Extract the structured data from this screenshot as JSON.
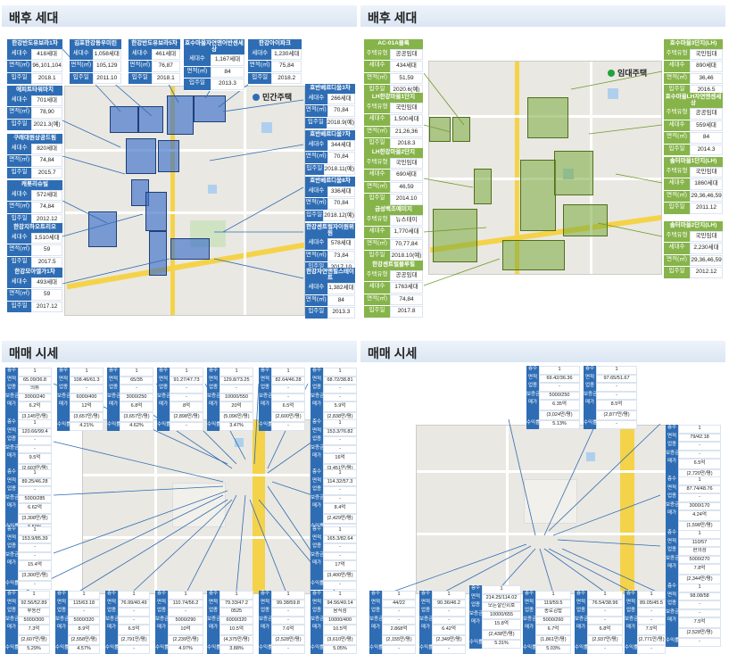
{
  "sections": {
    "tl": "배후 세대",
    "tr": "배후 세대",
    "bl": "매매 시세",
    "br": "매매 시세"
  },
  "legend": {
    "private": "민간주택",
    "rental": "임대주택"
  },
  "colors": {
    "blue": "#2e6db4",
    "green": "#86b44a"
  },
  "tl_boxes": [
    {
      "h": "한강반도유보라1차",
      "rows": [
        [
          "세대수",
          "418세대"
        ],
        [
          "면적(㎡)",
          "96,101,104"
        ],
        [
          "입주일",
          "2018.1"
        ]
      ]
    },
    {
      "h": "김포한강동우미린",
      "rows": [
        [
          "세대수",
          "1,058세대"
        ],
        [
          "면적(㎡)",
          "105,129"
        ],
        [
          "입주일",
          "2011.10"
        ]
      ]
    },
    {
      "h": "한강반도유보라5차",
      "rows": [
        [
          "세대수",
          "461세대"
        ],
        [
          "면적(㎡)",
          "76,87"
        ],
        [
          "입주일",
          "2018.1"
        ]
      ]
    },
    {
      "h": "호수마을자연앤어반센세상",
      "rows": [
        [
          "세대수",
          "1,167세대"
        ],
        [
          "면적(㎡)",
          "84"
        ],
        [
          "입주일",
          "2013.3"
        ]
      ]
    },
    {
      "h": "한강아이파크",
      "rows": [
        [
          "세대수",
          "1,230세대"
        ],
        [
          "면적(㎡)",
          "75,84"
        ],
        [
          "입주일",
          "2018.2"
        ]
      ]
    },
    {
      "h": "에피트타워마치",
      "rows": [
        [
          "세대수",
          "701세대"
        ],
        [
          "면적(㎡)",
          "78,90"
        ],
        [
          "입주일",
          "2021.3(예)"
        ]
      ]
    },
    {
      "h": "구래대원상공드림",
      "rows": [
        [
          "세대수",
          "820세대"
        ],
        [
          "면적(㎡)",
          "74,84"
        ],
        [
          "입주일",
          "2015.7"
        ]
      ]
    },
    {
      "h": "캐롯리슈빌",
      "rows": [
        [
          "세대수",
          "572세대"
        ],
        [
          "면적(㎡)",
          "74,84"
        ],
        [
          "입주일",
          "2012.12"
        ]
      ]
    },
    {
      "h": "한강지하오트리오",
      "rows": [
        [
          "세대수",
          "1,510세대"
        ],
        [
          "면적(㎡)",
          "59"
        ],
        [
          "입주일",
          "2017.5"
        ]
      ]
    },
    {
      "h": "한강모아엘가1차",
      "rows": [
        [
          "세대수",
          "493세대"
        ],
        [
          "면적(㎡)",
          "59"
        ],
        [
          "입주일",
          "2017.12"
        ]
      ]
    },
    {
      "h": "호반베르디움3차",
      "rows": [
        [
          "세대수",
          "266세대"
        ],
        [
          "면적(㎡)",
          "70,84"
        ],
        [
          "입주일",
          "2018.9(예)"
        ]
      ]
    },
    {
      "h": "호반베르디움7차",
      "rows": [
        [
          "세대수",
          "344세대"
        ],
        [
          "면적(㎡)",
          "70,84"
        ],
        [
          "입주일",
          "2018.11(예)"
        ]
      ]
    },
    {
      "h": "호반베르디움8차",
      "rows": [
        [
          "세대수",
          "336세대"
        ],
        [
          "면적(㎡)",
          "70,84"
        ],
        [
          "입주일",
          "2018.12(예)"
        ]
      ]
    },
    {
      "h": "한강센트럴자이원위원",
      "rows": [
        [
          "세대수",
          "578세대"
        ],
        [
          "면적(㎡)",
          "73,84"
        ],
        [
          "입주일",
          "2017.10"
        ]
      ]
    },
    {
      "h": "한강자연앤힐스테이트",
      "rows": [
        [
          "세대수",
          "1,382세대"
        ],
        [
          "면적(㎡)",
          "84"
        ],
        [
          "입주일",
          "2013.3"
        ]
      ]
    }
  ],
  "tr_boxes": [
    {
      "h": "AC-01A블록",
      "rows": [
        [
          "주택유형",
          "공공임대"
        ],
        [
          "세대수",
          "434세대"
        ],
        [
          "면적(㎡)",
          "51,59"
        ],
        [
          "입주일",
          "2020.6(예)"
        ]
      ]
    },
    {
      "h": "LH한강마을1단지",
      "rows": [
        [
          "주택유형",
          "국민임대"
        ],
        [
          "세대수",
          "1,500세대"
        ],
        [
          "면적(㎡)",
          "21,26,36"
        ],
        [
          "입주일",
          "2018.3"
        ]
      ]
    },
    {
      "h": "LH한강마을2단지",
      "rows": [
        [
          "주택유형",
          "국민임대"
        ],
        [
          "세대수",
          "690세대"
        ],
        [
          "면적(㎡)",
          "46,59"
        ],
        [
          "입주일",
          "2014.10"
        ]
      ]
    },
    {
      "h": "금성백조예미지",
      "rows": [
        [
          "주택유형",
          "뉴스테이"
        ],
        [
          "세대수",
          "1,770세대"
        ],
        [
          "면적(㎡)",
          "70,77,84"
        ],
        [
          "입주일",
          "2018.10(예)"
        ]
      ]
    },
    {
      "h": "한강센트럴블루힐",
      "rows": [
        [
          "주택유형",
          "공공임대"
        ],
        [
          "세대수",
          "1763세대"
        ],
        [
          "면적(㎡)",
          "74,84"
        ],
        [
          "입주일",
          "2017.8"
        ]
      ]
    },
    {
      "h": "호수마을3단지(LH)",
      "rows": [
        [
          "주택유형",
          "국민임대"
        ],
        [
          "세대수",
          "890세대"
        ],
        [
          "면적(㎡)",
          "36,46"
        ],
        [
          "입주일",
          "2016.5"
        ]
      ]
    },
    {
      "h": "호수마을LH자연앤센세상",
      "rows": [
        [
          "주택유형",
          "공공임대"
        ],
        [
          "세대수",
          "559세대"
        ],
        [
          "면적(㎡)",
          "84"
        ],
        [
          "입주일",
          "2014.3"
        ]
      ]
    },
    {
      "h": "솔터마을1단지(LH)",
      "rows": [
        [
          "주택유형",
          "국민임대"
        ],
        [
          "세대수",
          "1860세대"
        ],
        [
          "면적(㎡)",
          "29,36,46,59"
        ],
        [
          "입주일",
          "2011.12"
        ]
      ]
    },
    {
      "h": "솔터마을2단지(LH)",
      "rows": [
        [
          "주택유형",
          "국민임대"
        ],
        [
          "세대수",
          "2,230세대"
        ],
        [
          "면적(㎡)",
          "29,36,46,59"
        ],
        [
          "입주일",
          "2012.12"
        ]
      ]
    }
  ],
  "bl_cards": [
    [
      "1",
      "65.09/36.8",
      "의류",
      "3000/240",
      "6.2억",
      "(3,145만/평)",
      "4.88%"
    ],
    [
      "1",
      "108.46/61.3",
      "-",
      "6000/400",
      "12억",
      "(3,657만/평)",
      "4.21%"
    ],
    [
      "1",
      "65/35",
      "-",
      "3000/250",
      "6.8억",
      "(3,657만/평)",
      "4.62%"
    ],
    [
      "1",
      "91.27/47.73",
      "-",
      "-",
      "8억",
      "(2,898만/평)",
      "-"
    ],
    [
      "1",
      "129.8/73.25",
      "-",
      "10000/550",
      "20억",
      "(5,096만/평)",
      "3.47%"
    ],
    [
      "1",
      "82.64/46.28",
      "-",
      "-",
      "6.5억",
      "(2,600만/평)",
      "-"
    ],
    [
      "1",
      "68.72/38.81",
      "-",
      "-",
      "5.9억",
      "(2,838만/평)",
      "-"
    ],
    [
      "1",
      "120.66/99.4",
      "-",
      "-",
      "9.5억",
      "(2,603만/평)",
      "-"
    ],
    [
      "1",
      "153.3/76.82",
      "-",
      "-",
      "16억",
      "(3,451만/평)",
      "-"
    ],
    [
      "1",
      "89.25/46.28",
      "-",
      "5000/285",
      "6.62억",
      "(3,308만/평)",
      "5.59%"
    ],
    [
      "1",
      "114.32/57.3",
      "-",
      "-",
      "8.4억",
      "(2,429만/평)",
      "-"
    ],
    [
      "1",
      "153.9/85.39",
      "-",
      "-",
      "15.4억",
      "(3,300만/평)",
      "-"
    ],
    [
      "1",
      "165.3/82.64",
      "-",
      "-",
      "17억",
      "(3,400만/평)",
      "-"
    ],
    [
      "1",
      "92.56/52.89",
      "부동산",
      "5000/300",
      "7.3억",
      "(2,607만/평)",
      "5.29%"
    ],
    [
      "1",
      "115/63.18",
      "-",
      "5000/320",
      "8.9억",
      "(2,558만/평)",
      "4.57%"
    ],
    [
      "1",
      "76.99/40.49",
      "-",
      "-",
      "6.5억",
      "(2,791만/평)",
      "-"
    ],
    [
      "1",
      "110.74/56.2",
      "-",
      "5000/290",
      "10억",
      "(2,239만/평)",
      "4.97%"
    ],
    [
      "1",
      "79.33/47.2",
      "0525",
      "6000/320",
      "10.5억",
      "(4,375만/평)",
      "3.88%"
    ],
    [
      "1",
      "99.38/59.8",
      "-",
      "-",
      "7.6억",
      "(2,528만/평)",
      "-"
    ],
    [
      "1",
      "94.56/49.14",
      "음식점",
      "10000/400",
      "10.5억",
      "(3,610만/평)",
      "5.05%"
    ]
  ],
  "br_cards": [
    [
      "1",
      "69.42/36.36",
      "-",
      "5000/250",
      "6.35억",
      "(3,024만/평)",
      "5.13%"
    ],
    [
      "1",
      "97.65/51.67",
      "-",
      "-",
      "8.5억",
      "(2,877만/평)",
      "-"
    ],
    [
      "1",
      "79/42.18",
      "-",
      "-",
      "6.5억",
      "(2,720만/평)",
      "-"
    ],
    [
      "1",
      "87.74/48.76",
      "-",
      "3000/170",
      "4.24억",
      "(1,598만/평)",
      "5.18%"
    ],
    [
      "1",
      "110/57",
      "편의점",
      "5000/270",
      "7.8억",
      "(2,344만/평)",
      "4.44%"
    ],
    [
      "1",
      "98.08/58",
      "-",
      "-",
      "7.5억",
      "(2,528만/평)",
      "-"
    ],
    [
      "1",
      "44/22",
      "-",
      "-",
      "2.868억",
      "(2,155만/평)",
      "-"
    ],
    [
      "1",
      "90.36/46.2",
      "-",
      "-",
      "6.42억",
      "(2,349만/평)",
      "-"
    ],
    [
      "1",
      "214.25/114.02",
      "모든절인회호",
      "10000/655",
      "15.8억",
      "(2,438만/평)",
      "5.31%"
    ],
    [
      "1",
      "119/59.5",
      "종로김밥",
      "5000/260",
      "6.7억",
      "(1,861만/평)",
      "5.03%"
    ],
    [
      "1",
      "76.54/38.96",
      "-",
      "-",
      "6.8억",
      "(2,937만/평)",
      "-"
    ],
    [
      "1",
      "89.05/45.5",
      "-",
      "-",
      "7.5억",
      "(2,771만/평)",
      "-"
    ]
  ],
  "card_keys": [
    "층수",
    "면적",
    "업종",
    "보증금",
    "매가",
    "수익률"
  ]
}
